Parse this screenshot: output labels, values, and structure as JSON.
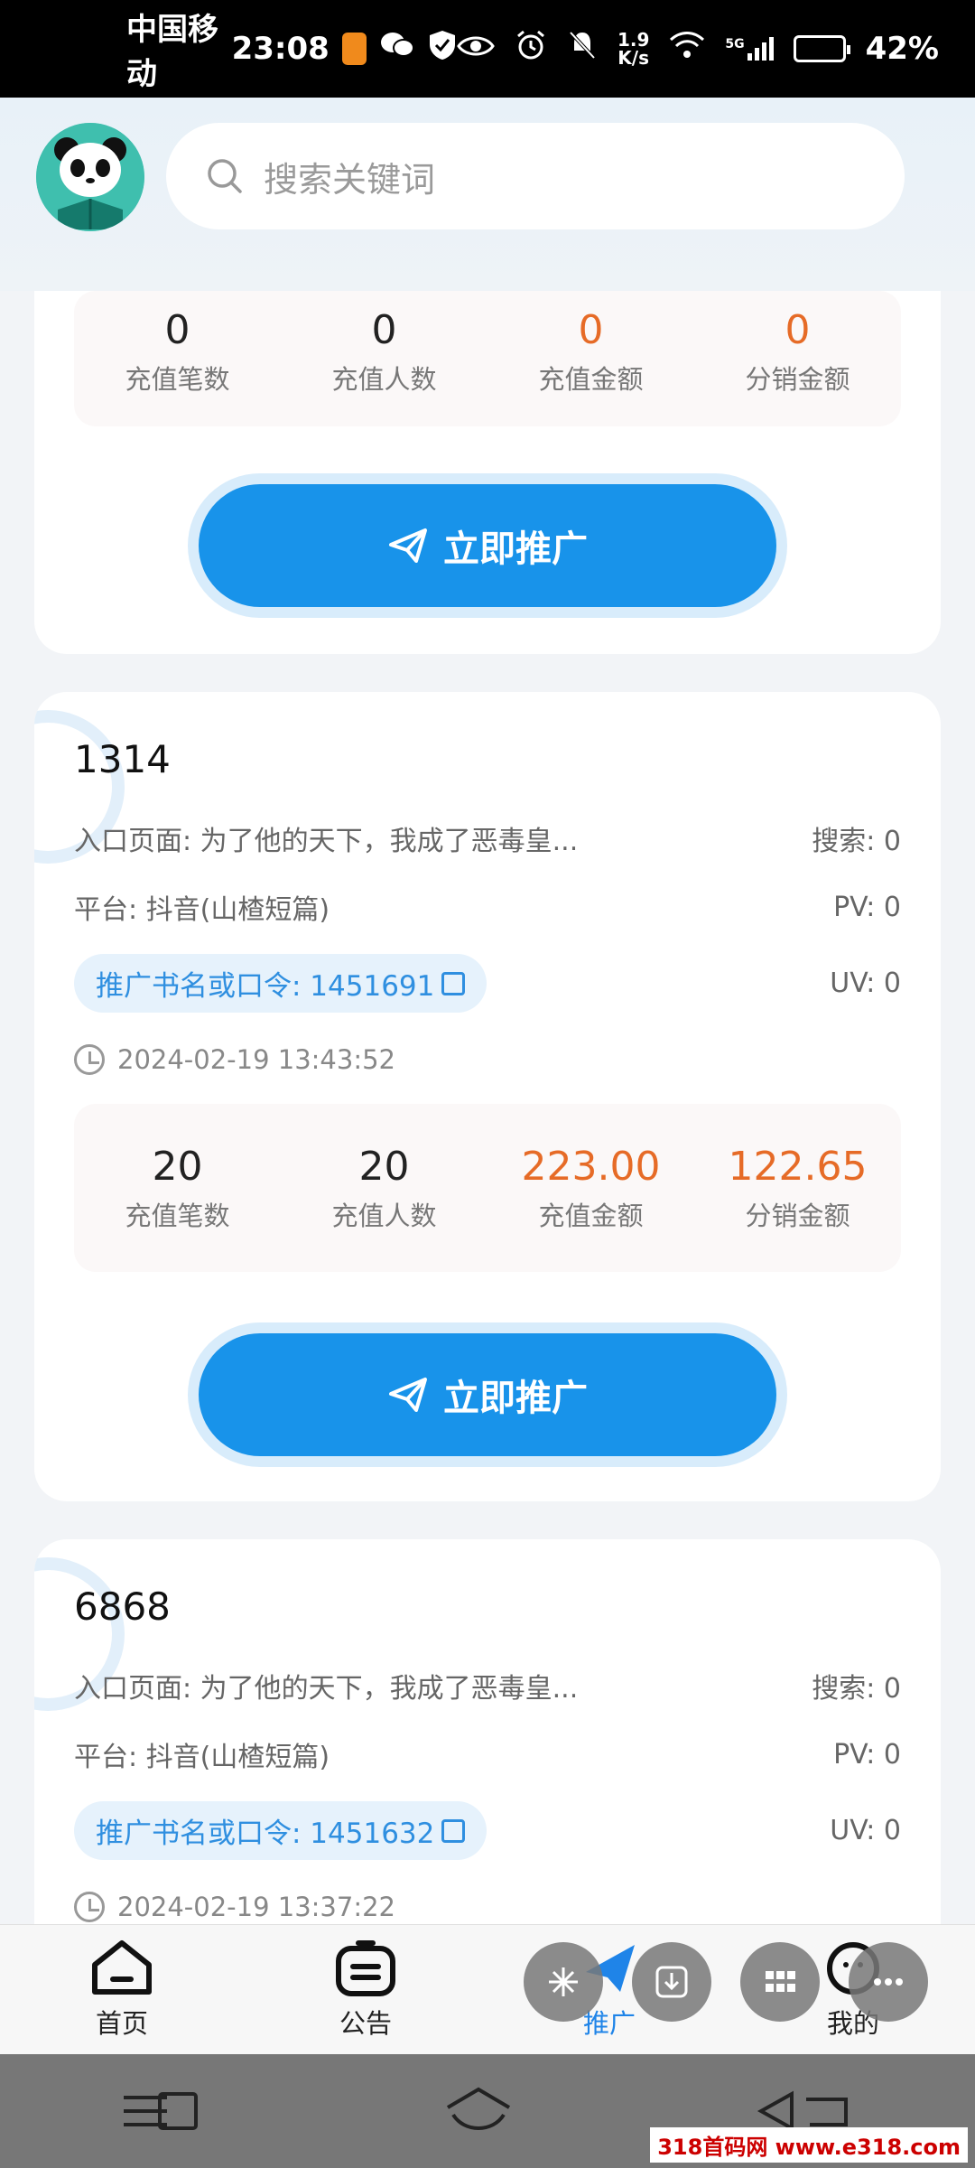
{
  "status_bar": {
    "carrier": "中国移动",
    "time": "23:08",
    "speed": "1.9",
    "speed_unit": "K/s",
    "network": "5G",
    "battery": "42%"
  },
  "header": {
    "search_placeholder": "搜索关键词"
  },
  "top_card": {
    "stats": [
      {
        "value": "0",
        "label": "充值笔数",
        "highlight": false
      },
      {
        "value": "0",
        "label": "充值人数",
        "highlight": false
      },
      {
        "value": "0",
        "label": "充值金额",
        "highlight": true
      },
      {
        "value": "0",
        "label": "分销金额",
        "highlight": true
      }
    ],
    "promote_label": "立即推广"
  },
  "cards": [
    {
      "title": "1314",
      "entry": "入口页面: 为了他的天下，我成了恶毒皇...",
      "search": "搜索: 0",
      "platform": "平台: 抖音(山楂短篇)",
      "pv": "PV: 0",
      "tag": "推广书名或口令: 1451691",
      "uv": "UV: 0",
      "time": "2024-02-19 13:43:52",
      "stats": [
        {
          "value": "20",
          "label": "充值笔数",
          "highlight": false
        },
        {
          "value": "20",
          "label": "充值人数",
          "highlight": false
        },
        {
          "value": "223.00",
          "label": "充值金额",
          "highlight": true
        },
        {
          "value": "122.65",
          "label": "分销金额",
          "highlight": true
        }
      ],
      "promote_label": "立即推广"
    },
    {
      "title": "6868",
      "entry": "入口页面: 为了他的天下，我成了恶毒皇...",
      "search": "搜索: 0",
      "platform": "平台: 抖音(山楂短篇)",
      "pv": "PV: 0",
      "tag": "推广书名或口令: 1451632",
      "uv": "UV: 0",
      "time": "2024-02-19 13:37:22"
    }
  ],
  "tabbar": {
    "home": "首页",
    "notice": "公告",
    "promote": "推广",
    "mine": "我的"
  },
  "colors": {
    "accent": "#1893ea",
    "highlight": "#e66b27"
  },
  "watermark": "318首码网 www.e318.com"
}
